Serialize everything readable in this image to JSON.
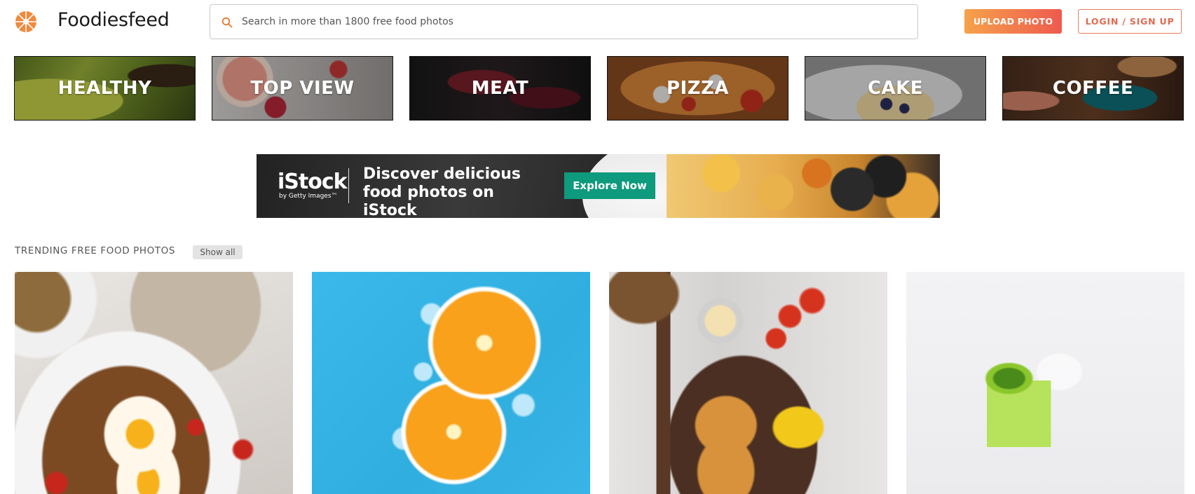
{
  "header": {
    "logo_text": "Foodiesfeed",
    "search_placeholder": "Search in more than 1800 free food photos",
    "upload_label": "UPLOAD PHOTO",
    "login_label": "LOGIN / SIGN UP"
  },
  "categories": [
    {
      "label": "HEALTHY"
    },
    {
      "label": "TOP VIEW"
    },
    {
      "label": "MEAT"
    },
    {
      "label": "PIZZA"
    },
    {
      "label": "CAKE"
    },
    {
      "label": "COFFEE"
    }
  ],
  "banner": {
    "logo": "iStock",
    "logo_sub": "by Getty Images™",
    "headline": "Discover delicious food photos on iStock",
    "cta": "Explore Now"
  },
  "trending": {
    "title": "TRENDING FREE FOOD PHOTOS",
    "show_all": "Show all"
  },
  "colors": {
    "accent_start": "#f6a24a",
    "accent_end": "#ee5a4f",
    "banner_cta": "#0e9a7c"
  }
}
